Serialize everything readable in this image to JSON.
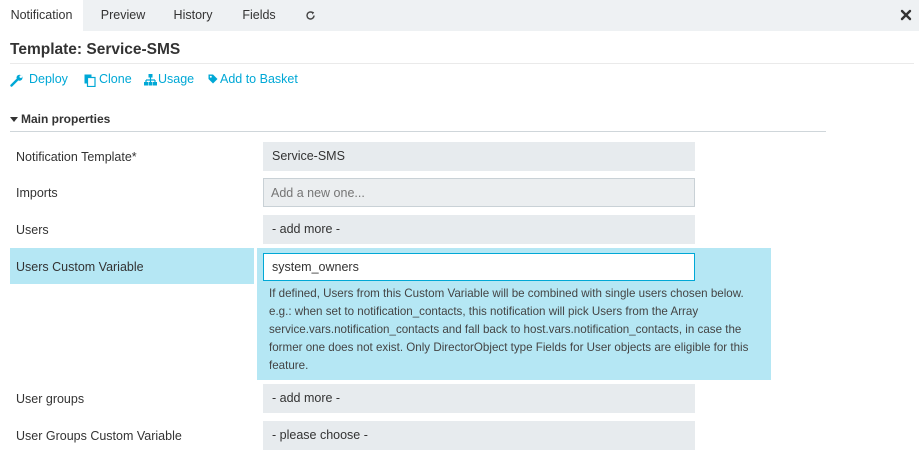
{
  "tabs": [
    {
      "label": "Notification",
      "active": true
    },
    {
      "label": "Preview",
      "active": false
    },
    {
      "label": "History",
      "active": false
    },
    {
      "label": "Fields",
      "active": false
    }
  ],
  "icons": {
    "refresh": "refresh-icon",
    "close": "close-icon",
    "deploy": "wrench-icon",
    "clone": "copy-icon",
    "usage": "sitemap-icon",
    "basket": "tag-icon",
    "section_toggle": "caret-down-icon"
  },
  "title": "Template: Service-SMS",
  "actions": {
    "deploy": "Deploy",
    "clone": "Clone",
    "usage": "Usage",
    "basket": "Add to Basket"
  },
  "section": {
    "label": "Main properties"
  },
  "fields": {
    "notification_template": {
      "label": "Notification Template*",
      "value": "Service-SMS"
    },
    "imports": {
      "label": "Imports",
      "placeholder": "Add a new one..."
    },
    "users": {
      "label": "Users",
      "value": "- add more -"
    },
    "users_custom_variable": {
      "label": "Users Custom Variable",
      "value": "system_owners",
      "help": "If defined, Users from this Custom Variable will be combined with single users chosen below. e.g.: when set to notification_contacts, this notification will pick Users from the Array service.vars.notification_contacts and fall back to host.vars.notification_contacts, in case the former one does not exist. Only DirectorObject type Fields for User objects are eligible for this feature."
    },
    "user_groups": {
      "label": "User groups",
      "value": "- add more -"
    },
    "user_groups_custom_variable": {
      "label": "User Groups Custom Variable",
      "value": "- please choose -"
    }
  },
  "colors": {
    "accent": "#00a8d6",
    "highlight": "#b5e7f4",
    "field_bg": "#e7ebee",
    "tabbar_bg": "#eef1f3"
  }
}
